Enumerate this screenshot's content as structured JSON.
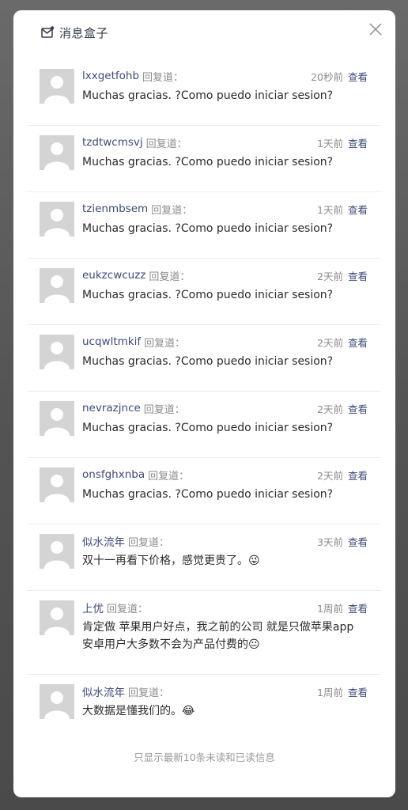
{
  "modal": {
    "title": "消息盒子",
    "close_icon": "close-icon",
    "header_icon": "mail-icon",
    "footer_note": "只显示最新10条未读和已读信息"
  },
  "messages": [
    {
      "username": "lxxgetfohb",
      "reply_label": "回复道：",
      "time": "20秒前",
      "view_label": "查看",
      "text": "Muchas gracias. ?Como puedo iniciar sesion?"
    },
    {
      "username": "tzdtwcmsvj",
      "reply_label": "回复道：",
      "time": "1天前",
      "view_label": "查看",
      "text": "Muchas gracias. ?Como puedo iniciar sesion?"
    },
    {
      "username": "tzienmbsem",
      "reply_label": "回复道：",
      "time": "1天前",
      "view_label": "查看",
      "text": "Muchas gracias. ?Como puedo iniciar sesion?"
    },
    {
      "username": "eukzcwcuzz",
      "reply_label": "回复道：",
      "time": "2天前",
      "view_label": "查看",
      "text": "Muchas gracias. ?Como puedo iniciar sesion?"
    },
    {
      "username": "ucqwltmkif",
      "reply_label": "回复道：",
      "time": "2天前",
      "view_label": "查看",
      "text": "Muchas gracias. ?Como puedo iniciar sesion?"
    },
    {
      "username": "nevrazjnce",
      "reply_label": "回复道：",
      "time": "2天前",
      "view_label": "查看",
      "text": "Muchas gracias. ?Como puedo iniciar sesion?"
    },
    {
      "username": "onsfghxnba",
      "reply_label": "回复道：",
      "time": "2天前",
      "view_label": "查看",
      "text": "Muchas gracias. ?Como puedo iniciar sesion?"
    },
    {
      "username": "似水流年",
      "reply_label": "回复道：",
      "time": "3天前",
      "view_label": "查看",
      "text": "双十一再看下价格，感觉更贵了。😜"
    },
    {
      "username": "上优",
      "reply_label": "回复道：",
      "time": "1周前",
      "view_label": "查看",
      "text": "肯定做 苹果用户好点，我之前的公司 就是只做苹果app 安卓用户大多数不会为产品付费的😐"
    },
    {
      "username": "似水流年",
      "reply_label": "回复道：",
      "time": "1周前",
      "view_label": "查看",
      "text": "大数据是懂我们的。😂"
    }
  ]
}
